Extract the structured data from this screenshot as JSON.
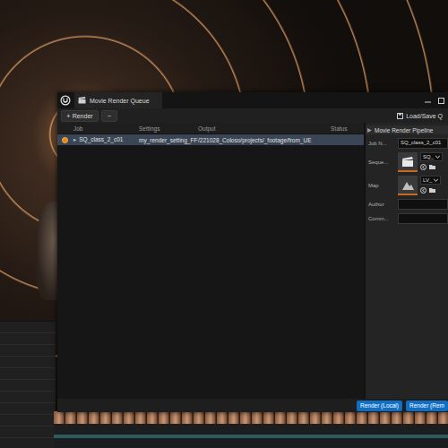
{
  "window": {
    "title": "Movie Render Queue"
  },
  "toolbar": {
    "render_plus": "+",
    "render_button": "Render",
    "remove_button": "−",
    "load_save": "Load/Save Q"
  },
  "table": {
    "columns": [
      "Job",
      "Settings",
      "Output",
      "Status"
    ],
    "rows": [
      {
        "expand": "▸",
        "job": "SQ_class_2_c01",
        "settings": "my_render_setting_FF",
        "output": "/221028_Coloso/projects/_footage/from_UE",
        "selected": true,
        "enabled": true
      }
    ]
  },
  "details": {
    "title": "Movie Render Pipeline",
    "fields": [
      {
        "label": "Job N...",
        "kind": "text",
        "value": "SQ_class_2_c01"
      },
      {
        "label": "Seque...",
        "kind": "asset",
        "value": "SQ_"
      },
      {
        "label": "Map",
        "kind": "asset",
        "value": "LV_"
      },
      {
        "label": "Author",
        "kind": "text",
        "value": ""
      },
      {
        "label": "Comm...",
        "kind": "text",
        "value": ""
      }
    ]
  },
  "footer": {
    "buttons": [
      {
        "label": "Render (Local)"
      },
      {
        "label": "Render (Rem"
      }
    ]
  }
}
